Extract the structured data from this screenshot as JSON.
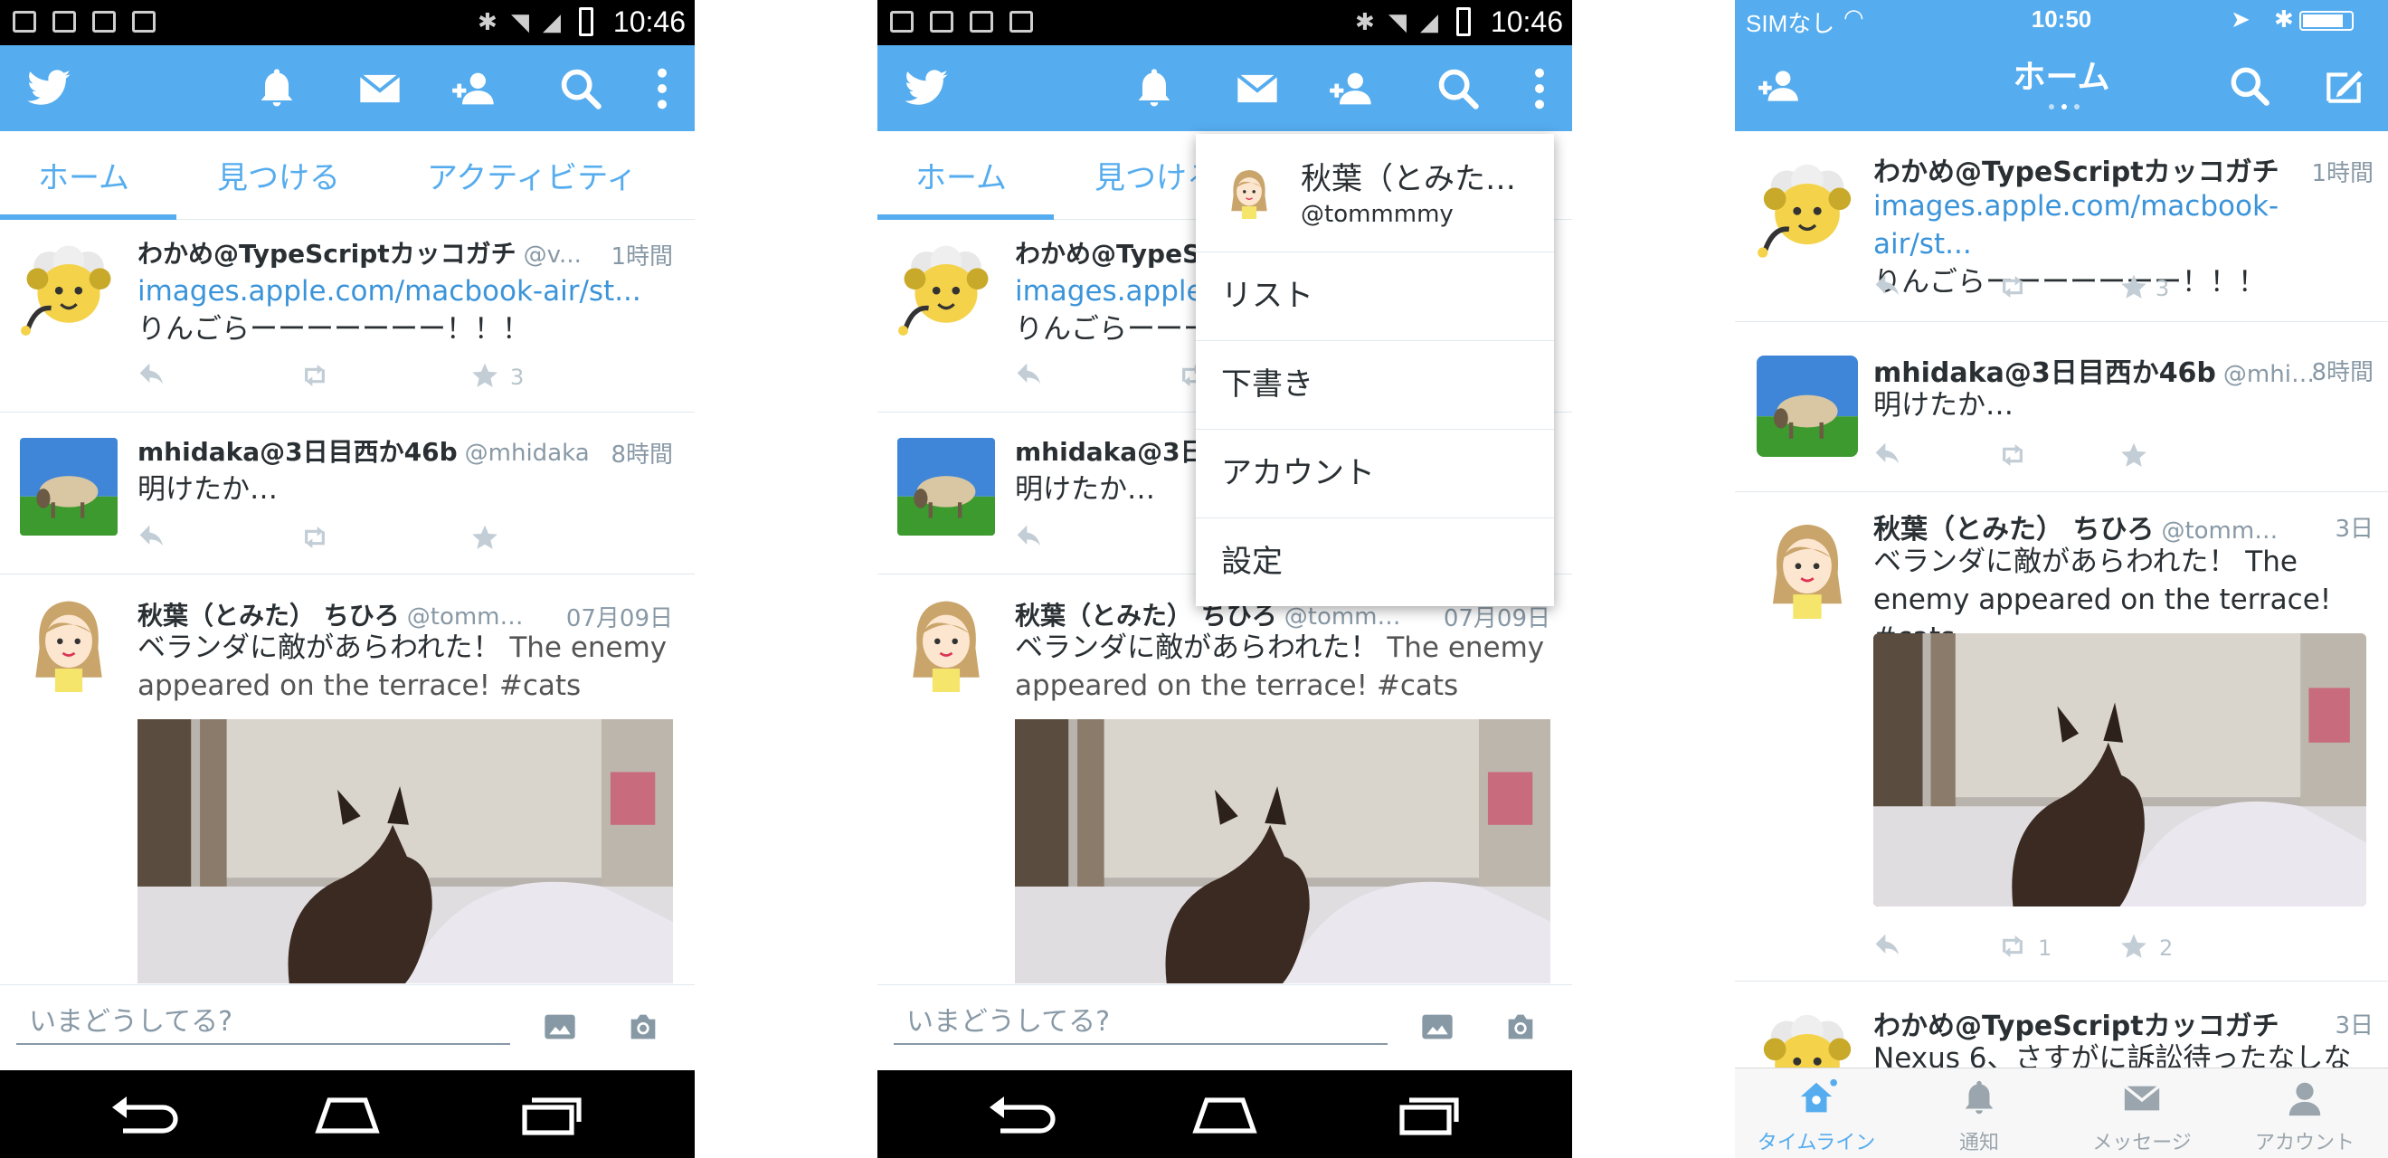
{
  "android": {
    "status": {
      "time": "10:46"
    },
    "tabs": [
      "ホーム",
      "見つける",
      "アクティビティ"
    ],
    "tweets": [
      {
        "name": "わかめ@TypeScriptカッコガチ",
        "handle": "@v...",
        "time": "1時間",
        "link": "images.apple.com/macbook-air/st...",
        "text": "りんごらーーーーーーー！！！",
        "favorites": "3"
      },
      {
        "name": "mhidaka@3日目西か46b",
        "handle": "@mhidaka",
        "time": "8時間",
        "text": "明けたか…"
      },
      {
        "name": "秋葉（とみた） ちひろ",
        "handle": "@tomm…",
        "time": "07月09日",
        "text_ja": "ベランダに敵があらわれた！",
        "text_en": "The enemy appeared on the terrace! #cats"
      }
    ],
    "compose_placeholder": "いまどうしてる?",
    "overflow_menu": {
      "account_name": "秋葉（とみた…",
      "account_handle": "@tommmmy",
      "items": [
        "リスト",
        "下書き",
        "アカウント",
        "設定"
      ]
    }
  },
  "ios": {
    "status": {
      "carrier": "SIMなし",
      "time": "10:50"
    },
    "title": "ホーム",
    "tweets": [
      {
        "name": "わかめ@TypeScriptカッコガチ",
        "time": "1時間",
        "link": "images.apple.com/macbook-air/st...",
        "text": "りんごらーーーーーーー！！！",
        "favorites": "3"
      },
      {
        "name": "mhidaka@3日目西か46b",
        "handle": "@mhi…",
        "time": "8時間",
        "text": "明けたか…"
      },
      {
        "name": "秋葉（とみた） ちひろ",
        "handle": "@tomm…",
        "time": "3日",
        "text": "ベランダに敵があらわれた！ The enemy appeared on the terrace! #cats",
        "retweets": "1",
        "favorites": "2"
      },
      {
        "name": "わかめ@TypeScriptカッコガチ",
        "time": "3日",
        "text": "Nexus 6、さすがに訴訟待ったなしな"
      }
    ],
    "tabbar": [
      "タイムライン",
      "通知",
      "メッセージ",
      "アカウント"
    ]
  },
  "icons": {
    "status": [
      "image-icon",
      "gmail-icon",
      "download-icon",
      "clipboard-icon",
      "bluetooth-icon",
      "wifi-icon",
      "signal-icon",
      "battery-icon"
    ],
    "actionbar": [
      "twitter-bird-icon",
      "bell-icon",
      "envelope-icon",
      "add-user-icon",
      "search-icon",
      "overflow-menu-icon"
    ],
    "tweet_actions": [
      "reply-icon",
      "retweet-icon",
      "favorite-star-icon"
    ],
    "compose": [
      "gallery-icon",
      "camera-icon"
    ],
    "nav": [
      "back-icon",
      "home-icon",
      "recent-apps-icon"
    ]
  },
  "colors": {
    "brand": "#55acee",
    "link": "#3b94d9",
    "muted": "#8899a6"
  }
}
